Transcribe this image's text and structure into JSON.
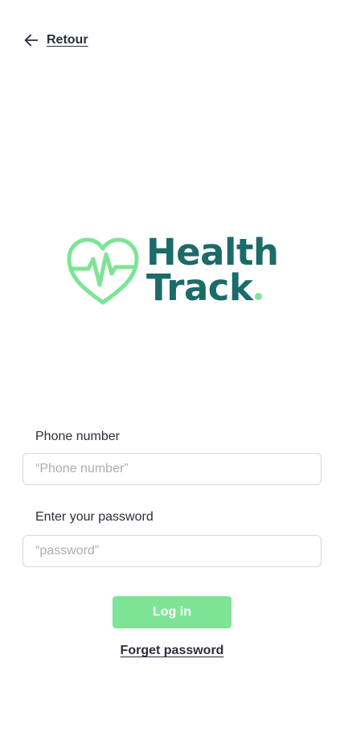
{
  "nav": {
    "back_label": "Retour",
    "back_icon": "arrow-left-icon"
  },
  "logo": {
    "line1": "Health",
    "line2": "Track",
    "icon": "heart-pulse-icon",
    "colors": {
      "wordmark": "#1b6b69",
      "accent": "#7ee495"
    }
  },
  "form": {
    "phone": {
      "label": "Phone number",
      "placeholder": "“Phone number”",
      "value": ""
    },
    "password": {
      "label": "Enter your password",
      "placeholder": "“password”",
      "value": ""
    },
    "login_label": "Log in",
    "forgot_label": "Forget password"
  },
  "colors": {
    "primary_button": "#7ee495",
    "text": "#2a2f3a",
    "border": "#d6d9de",
    "placeholder": "#a9adb4"
  }
}
